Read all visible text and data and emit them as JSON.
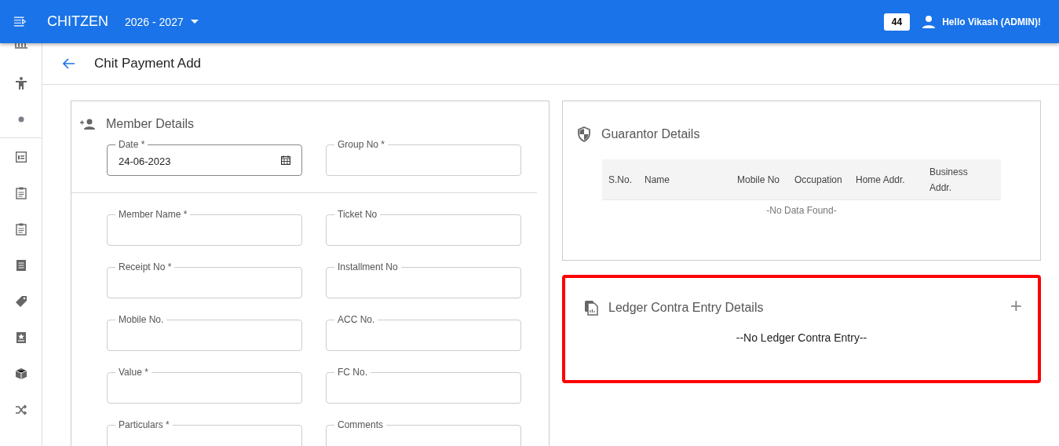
{
  "header": {
    "brand": "CHITZEN",
    "year": "2026 - 2027",
    "count": "44",
    "user": "Hello Vikash (ADMIN)!"
  },
  "page": {
    "title": "Chit Payment Add"
  },
  "member_details": {
    "title": "Member Details",
    "top_fields": [
      {
        "label": "Date *",
        "value": "24-06-2023",
        "kind": "date"
      },
      {
        "label": "Group No *",
        "kind": "text"
      }
    ],
    "fields": [
      {
        "label": "Member Name *"
      },
      {
        "label": "Ticket No"
      },
      {
        "label": "Receipt No *"
      },
      {
        "label": "Installment No"
      },
      {
        "label": "Mobile No."
      },
      {
        "label": "ACC No."
      },
      {
        "label": "Value *"
      },
      {
        "label": "FC No."
      },
      {
        "label": "Particulars *"
      },
      {
        "label": "Comments"
      }
    ]
  },
  "guarantor_details": {
    "title": "Guarantor Details",
    "columns": [
      "S.No.",
      "Name",
      "Mobile No",
      "Occupation",
      "Home Addr.",
      "Business Addr."
    ],
    "empty": "-No Data Found-"
  },
  "ledger_contra": {
    "title": "Ledger Contra Entry Details",
    "add": "+",
    "empty": "--No Ledger Contra Entry--",
    "highlighted": true
  }
}
